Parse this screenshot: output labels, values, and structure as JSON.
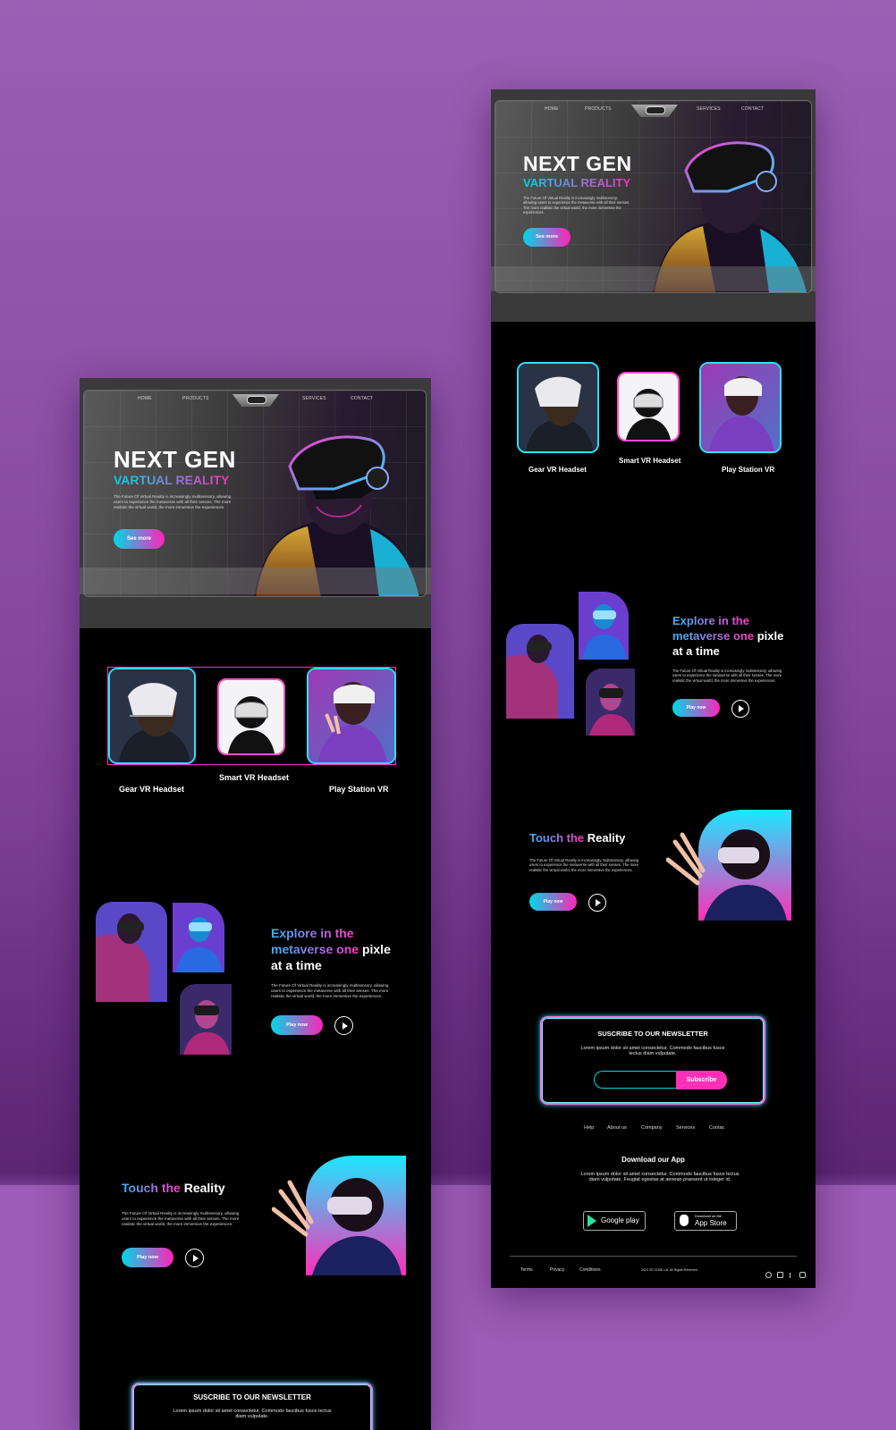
{
  "nav": {
    "home": "HOME",
    "products": "PRODUCTS",
    "services": "SERVICES",
    "contact": "CONTACT"
  },
  "hero": {
    "title": "NEXT GEN",
    "subtitle": "VARTUAL REALITY",
    "description": "The Future Of Virtual Reality is increasingly multisensory, allowing users to experience the metaverse with all their senses. The more realistic the virtual world, the more immersive the experiences.",
    "cta": "See more"
  },
  "products": [
    {
      "label": "Gear VR Headset"
    },
    {
      "label": "Smart VR Headset"
    },
    {
      "label": "Play Station VR"
    }
  ],
  "explore": {
    "title_a": "Explore in the",
    "title_b": "metaverse one",
    "title_c": "pixle",
    "title_d": "at a time",
    "description": "The Future Of Virtual Reality is increasingly multisensory, allowing users to experience the metaverse with all their senses. The more realistic the virtual world, the more immersive the experiences.",
    "cta": "Play now"
  },
  "touch": {
    "title_a": "Touch the",
    "title_b": "Reality",
    "description": "The Future Of Virtual Reality is increasingly multisensory, allowing users to experience the metaverse with all their senses. The more realistic the virtual world, the more immersive the experiences.",
    "cta": "Play now"
  },
  "newsletter": {
    "title": "SUSCRIBE TO OUR NEWSLETTER",
    "text": "Lorem ipsum dolor sit amet consectetur. Commodo faucibus fusce lectus diam vulputate.",
    "button": "Subscribe"
  },
  "footer_links": [
    "Help",
    "About us",
    "Company",
    "Services",
    "Contac"
  ],
  "app": {
    "title": "Download our App",
    "text": "Lorem ipsum dolor sit amet consectetur. Commodo faucibus fusce lectus diam vulputate. Feugiat egestas at aenean praesent ut integer id.",
    "google": "Google play",
    "apple_small": "Download on the",
    "apple": "App Store"
  },
  "bottom": {
    "terms": "Terms",
    "privacy": "Privacy",
    "conditions": "Conditions",
    "copyright": "2024 VR ZONE Ltd. All Rights Reserved"
  },
  "colors": {
    "cyan": "#00d8e8",
    "pink": "#ff23b9",
    "background": "#9a60b5"
  }
}
